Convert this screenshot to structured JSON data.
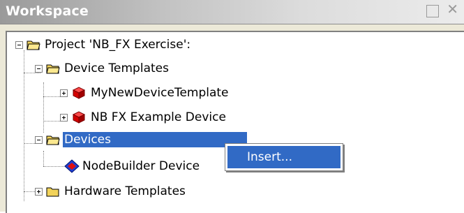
{
  "window": {
    "title": "Workspace"
  },
  "tree": {
    "project": "Project 'NB_FX Exercise':",
    "device_templates": "Device Templates",
    "template_1": "MyNewDeviceTemplate",
    "template_2": "NB FX Example Device",
    "devices": "Devices",
    "device_1": "NodeBuilder Device",
    "hardware_templates": "Hardware Templates"
  },
  "context_menu": {
    "insert": "Insert..."
  },
  "icons": {
    "folder": "folder-open-icon",
    "template": "red-cube-icon",
    "device": "blue-red-diamond-icon",
    "restore": "restore-window-icon",
    "close": "close-icon"
  },
  "colors": {
    "selection": "#316ac5",
    "folder_yellow": "#f2d35a"
  }
}
